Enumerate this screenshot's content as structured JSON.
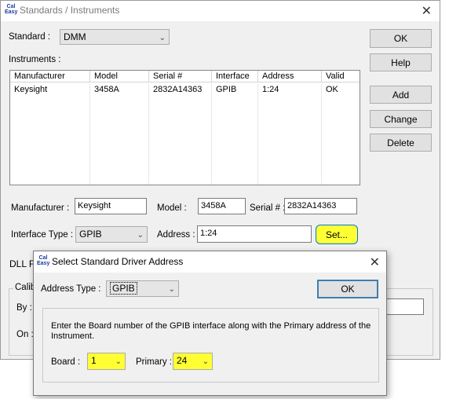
{
  "main_window": {
    "title": "Standards / Instruments",
    "icon_text": [
      "Cal",
      "Easy"
    ],
    "close_glyph": "✕",
    "standard_label": "Standard :",
    "standard_value": "DMM",
    "instruments_label": "Instruments :",
    "buttons": {
      "ok": "OK",
      "help": "Help",
      "add": "Add",
      "change": "Change",
      "delete": "Delete",
      "set": "Set..."
    },
    "table": {
      "columns": [
        "Manufacturer",
        "Model",
        "Serial #",
        "Interface",
        "Address",
        "Valid"
      ],
      "rows": [
        [
          "Keysight",
          "3458A",
          "2832A14363",
          "GPIB",
          "1:24",
          "OK"
        ]
      ]
    },
    "manufacturer_label": "Manufacturer :",
    "manufacturer_value": "Keysight",
    "model_label": "Model :",
    "model_value": "3458A",
    "serial_label": "Serial # :",
    "serial_value": "2832A14363",
    "interface_label": "Interface Type :",
    "interface_value": "GPIB",
    "address_label": "Address :",
    "address_value": "1:24",
    "dll_label": "DLL F",
    "calib_label": "Calib",
    "by_label": "By :",
    "on_label": "On :",
    "partial_field_value": "3"
  },
  "dialog": {
    "title": "Select Standard Driver Address",
    "icon_text": [
      "Cal",
      "Easy"
    ],
    "close_glyph": "✕",
    "address_type_label": "Address Type :",
    "address_type_value": "GPIB",
    "ok": "OK",
    "instructions": "Enter the Board number of the GPIB interface along with the Primary address of the Instrument.",
    "board_label": "Board :",
    "board_value": "1",
    "primary_label": "Primary :",
    "primary_value": "24"
  },
  "colors": {
    "highlight": "#ffff33",
    "default_button_border": "#3c7fb1"
  }
}
